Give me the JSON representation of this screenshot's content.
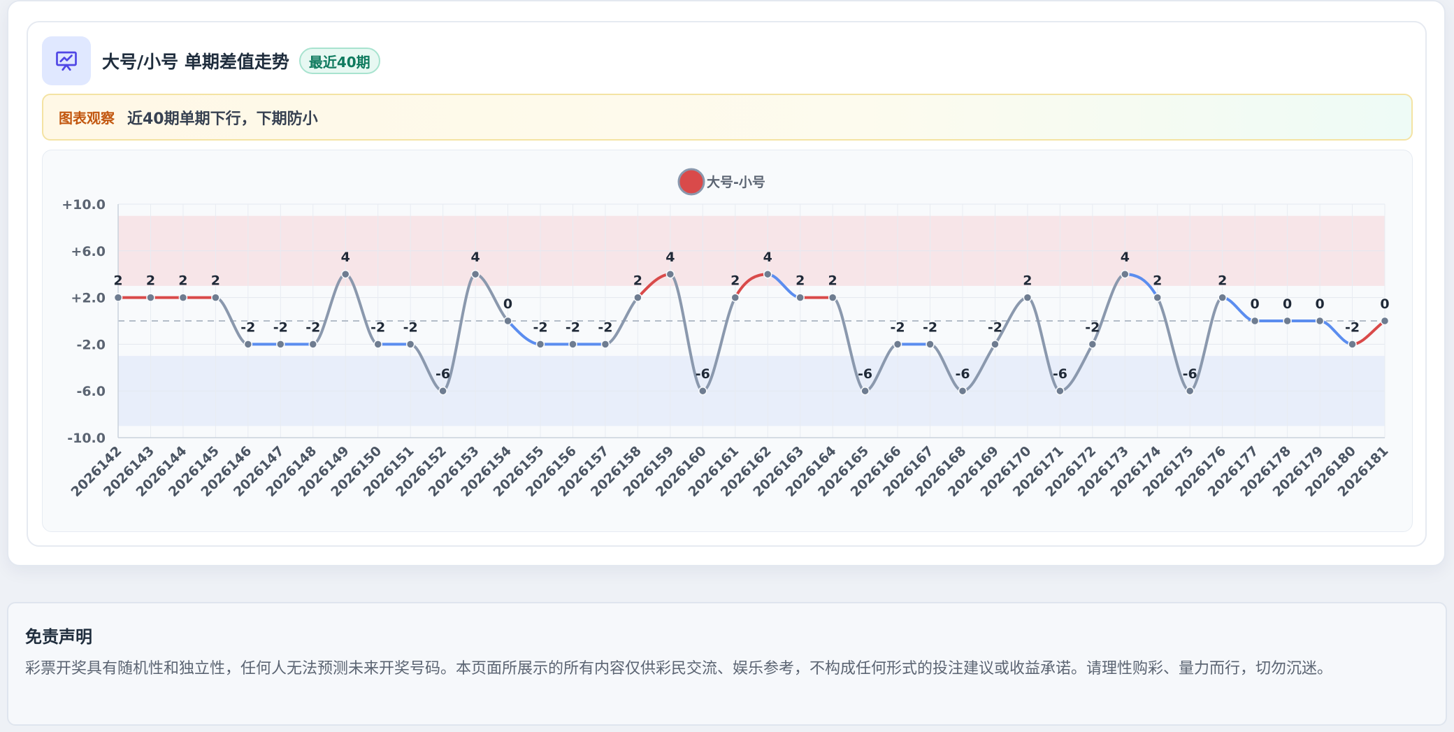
{
  "header": {
    "title": "大号/小号 单期差值走势",
    "badge": "最近40期",
    "icon": "presentation-chart-icon"
  },
  "note": {
    "label": "图表观察",
    "text": "近40期单期下行，下期防小"
  },
  "disclaimer": {
    "title": "免责声明",
    "text": "彩票开奖具有随机性和独立性，任何人无法预测未来开奖号码。本页面所展示的所有内容仅供彩民交流、娱乐参考，不构成任何形式的投注建议或收益承诺。请理性购彩、量力而行，切勿沉迷。"
  },
  "colors": {
    "up": "#d94a4a",
    "down": "#5b8def",
    "neutral": "#8a98ad",
    "positive_band": "#f7e5e8",
    "negative_band": "#e8eefa"
  },
  "chart_data": {
    "type": "line",
    "legend": "大号-小号",
    "legend_position": "top-center",
    "x": [
      "2026142",
      "2026143",
      "2026144",
      "2026145",
      "2026146",
      "2026147",
      "2026148",
      "2026149",
      "2026150",
      "2026151",
      "2026152",
      "2026153",
      "2026154",
      "2026155",
      "2026156",
      "2026157",
      "2026158",
      "2026159",
      "2026160",
      "2026161",
      "2026162",
      "2026163",
      "2026164",
      "2026165",
      "2026166",
      "2026167",
      "2026168",
      "2026169",
      "2026170",
      "2026171",
      "2026172",
      "2026173",
      "2026174",
      "2026175",
      "2026176",
      "2026177",
      "2026178",
      "2026179",
      "2026180",
      "2026181"
    ],
    "values": [
      2,
      2,
      2,
      2,
      -2,
      -2,
      -2,
      4,
      -2,
      -2,
      -6,
      4,
      0,
      -2,
      -2,
      -2,
      2,
      4,
      -6,
      2,
      4,
      2,
      2,
      -6,
      -2,
      -2,
      -6,
      -2,
      2,
      -6,
      -2,
      4,
      2,
      -6,
      2,
      0,
      0,
      0,
      -2,
      0
    ],
    "y_ticks": [
      "+10.0",
      "+6.0",
      "+2.0",
      "-2.0",
      "-6.0",
      "-10.0"
    ],
    "ylim": [
      -10,
      10
    ],
    "positive_band": [
      3,
      9
    ],
    "negative_band": [
      -9,
      -3
    ],
    "reference_line": 0,
    "grid": true
  }
}
